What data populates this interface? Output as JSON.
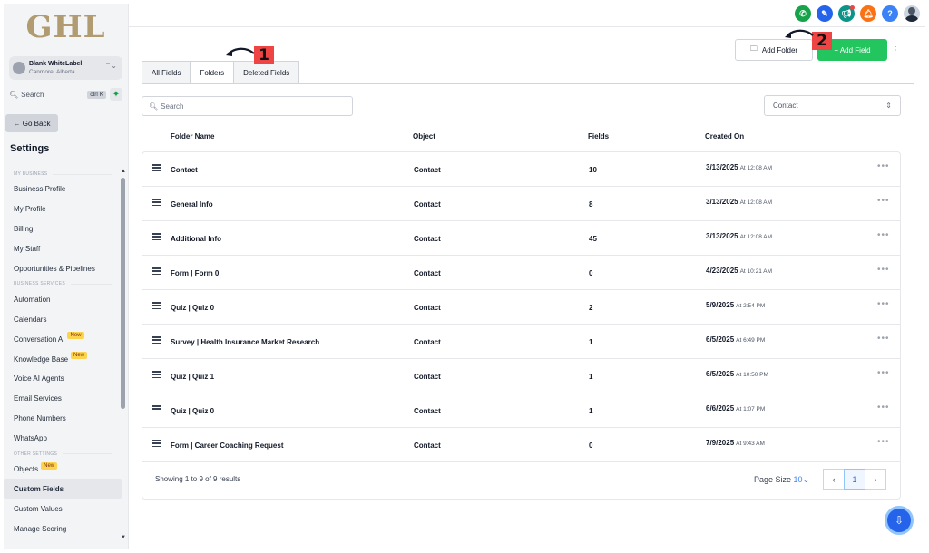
{
  "sidebar": {
    "logo": "GHL",
    "account": {
      "name": "Blank WhiteLabel",
      "location": "Canmore, Alberta"
    },
    "search": {
      "label": "Search",
      "shortcut": "ctrl K"
    },
    "go_back": "← Go Back",
    "settings_title": "Settings",
    "sections": {
      "my_business": "MY BUSINESS",
      "business_services": "BUSINESS SERVICES",
      "other_settings": "OTHER SETTINGS"
    },
    "items": {
      "business_profile": "Business Profile",
      "my_profile": "My Profile",
      "billing": "Billing",
      "my_staff": "My Staff",
      "opportunities": "Opportunities & Pipelines",
      "automation": "Automation",
      "calendars": "Calendars",
      "conversation_ai": "Conversation AI",
      "knowledge_base": "Knowledge Base",
      "voice_ai": "Voice AI Agents",
      "email_services": "Email Services",
      "phone_numbers": "Phone Numbers",
      "whatsapp": "WhatsApp",
      "objects": "Objects",
      "custom_fields": "Custom Fields",
      "custom_values": "Custom Values",
      "manage_scoring": "Manage Scoring"
    },
    "new_badge": "New"
  },
  "header": {
    "add_folder": "Add Folder",
    "add_field": "+ Add Field",
    "more": "⋮"
  },
  "tabs": [
    "All Fields",
    "Folders",
    "Deleted Fields"
  ],
  "annotations": {
    "mark1": "1",
    "mark2": "2"
  },
  "filters": {
    "search_placeholder": "Search",
    "object_select": "Contact"
  },
  "table": {
    "columns": [
      "Folder Name",
      "Object",
      "Fields",
      "Created On"
    ],
    "rows": [
      {
        "name": "Contact",
        "object": "Contact",
        "fields": "10",
        "date": "3/13/2025",
        "time": "At 12:08 AM"
      },
      {
        "name": "General Info",
        "object": "Contact",
        "fields": "8",
        "date": "3/13/2025",
        "time": "At 12:08 AM"
      },
      {
        "name": "Additional Info",
        "object": "Contact",
        "fields": "45",
        "date": "3/13/2025",
        "time": "At 12:08 AM"
      },
      {
        "name": "Form | Form 0",
        "object": "Contact",
        "fields": "0",
        "date": "4/23/2025",
        "time": "At 10:21 AM"
      },
      {
        "name": "Quiz | Quiz 0",
        "object": "Contact",
        "fields": "2",
        "date": "5/9/2025",
        "time": "At 2:54 PM"
      },
      {
        "name": "Survey | Health Insurance Market Research",
        "object": "Contact",
        "fields": "1",
        "date": "6/5/2025",
        "time": "At 6:49 PM"
      },
      {
        "name": "Quiz | Quiz 1",
        "object": "Contact",
        "fields": "1",
        "date": "6/5/2025",
        "time": "At 10:50 PM"
      },
      {
        "name": "Quiz | Quiz 0",
        "object": "Contact",
        "fields": "1",
        "date": "6/6/2025",
        "time": "At 1:07 PM"
      },
      {
        "name": "Form | Career Coaching Request",
        "object": "Contact",
        "fields": "0",
        "date": "7/9/2025",
        "time": "At 9:43 AM"
      }
    ]
  },
  "footer": {
    "showing": "Showing 1 to 9 of 9 results",
    "page_size_label": "Page Size",
    "page_size_value": "10",
    "current_page": "1"
  },
  "colors": {
    "primary_green": "#22c55e",
    "logo_gold": "#b19b70",
    "annotation_red": "#ef4444"
  }
}
